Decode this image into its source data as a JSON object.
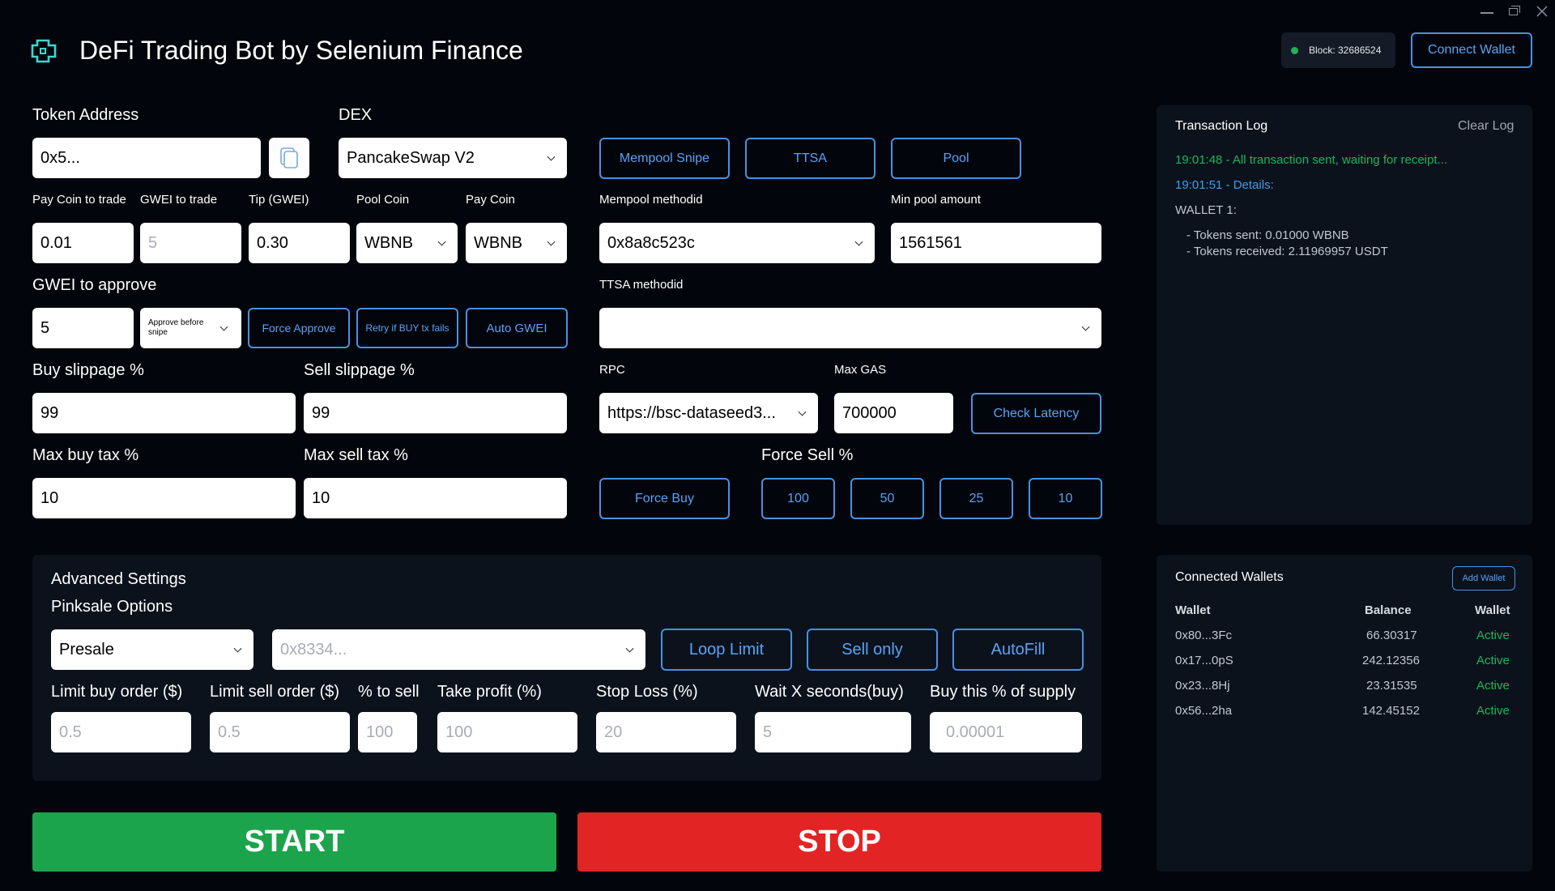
{
  "app": {
    "title": "DeFi Trading Bot by Selenium Finance",
    "block": "Block: 32686524",
    "connect_wallet": "Connect Wallet",
    "block_status_color": "#1fb45a"
  },
  "form": {
    "token_address_label": "Token Address",
    "token_address_value": "0x5...",
    "dex_label": "DEX",
    "dex_value": "PancakeSwap V2",
    "pay_coin_to_trade_label": "Pay Coin to trade",
    "pay_coin_to_trade_value": "0.01",
    "gwei_to_trade_label": "GWEI to trade",
    "gwei_to_trade_placeholder": "5",
    "tip_label": "Tip (GWEI)",
    "tip_value": "0.30",
    "pool_coin_label": "Pool Coin",
    "pool_coin_value": "WBNB",
    "pay_coin_label": "Pay Coin",
    "pay_coin_value": "WBNB",
    "gwei_to_approve_label": "GWEI to approve",
    "gwei_to_approve_value": "5",
    "approve_mode_value": "Approve before snipe",
    "force_approve": "Force Approve",
    "retry_buy": "Retry if BUY tx fails",
    "auto_gwei": "Auto GWEI",
    "buy_slippage_label": "Buy slippage %",
    "buy_slippage_value": "99",
    "sell_slippage_label": "Sell slippage %",
    "sell_slippage_value": "99",
    "max_buy_tax_label": "Max buy tax %",
    "max_buy_tax_value": "10",
    "max_sell_tax_label": "Max sell tax %",
    "max_sell_tax_value": "10"
  },
  "modes": {
    "mempool_snipe": "Mempool Snipe",
    "ttsa": "TTSA",
    "pool": "Pool",
    "mempool_methodid_label": "Mempool methodid",
    "mempool_methodid_value": "0x8a8c523c",
    "min_pool_amount_label": "Min pool amount",
    "min_pool_amount_value": "1561561",
    "ttsa_methodid_label": "TTSA methodid",
    "ttsa_methodid_value": "",
    "rpc_label": "RPC",
    "rpc_value": "https://bsc-dataseed3...",
    "max_gas_label": "Max GAS",
    "max_gas_value": "700000",
    "check_latency": "Check Latency",
    "force_buy": "Force Buy",
    "force_sell_label": "Force Sell %",
    "force_sell_options": [
      "100",
      "50",
      "25",
      "10"
    ]
  },
  "advanced": {
    "title": "Advanced Settings",
    "subtitle": "Pinksale Options",
    "sale_type_value": "Presale",
    "sale_address_placeholder": "0x8334...",
    "loop_limit": "Loop Limit",
    "sell_only": "Sell only",
    "autofill": "AutoFill",
    "limit_buy_label": "Limit buy order ($)",
    "limit_buy_placeholder": "0.5",
    "limit_sell_label": "Limit sell order ($)",
    "limit_sell_placeholder": "0.5",
    "pct_to_sell_label": "% to sell",
    "pct_to_sell_placeholder": "100",
    "take_profit_label": "Take profit (%)",
    "take_profit_placeholder": "100",
    "stop_loss_label": "Stop Loss (%)",
    "stop_loss_placeholder": "20",
    "wait_seconds_label": "Wait X seconds(buy)",
    "wait_seconds_placeholder": "5",
    "buy_pct_supply_label": "Buy this % of supply",
    "buy_pct_supply_placeholder": "0.00001"
  },
  "actions": {
    "start": "START",
    "stop": "STOP",
    "start_color": "#1ca44c",
    "stop_color": "#e22424"
  },
  "log": {
    "title": "Transaction Log",
    "clear": "Clear Log",
    "line1": "19:01:48 - All transaction sent, waiting for receipt...",
    "line2": "19:01:51 - Details:",
    "line3": "WALLET 1:",
    "line4": "- Tokens sent: 0.01000 WBNB",
    "line5": "- Tokens received: 2.11969957 USDT"
  },
  "wallets": {
    "title": "Connected Wallets",
    "add_wallet": "Add Wallet",
    "columns": [
      "Wallet",
      "Balance",
      "Wallet"
    ],
    "rows": [
      {
        "wallet": "0x80...3Fc",
        "balance": "66.30317",
        "status": "Active"
      },
      {
        "wallet": "0x17...0pS",
        "balance": "242.12356",
        "status": "Active"
      },
      {
        "wallet": "0x23...8Hj",
        "balance": "23.31535",
        "status": "Active"
      },
      {
        "wallet": "0x56...2ha",
        "balance": "142.45152",
        "status": "Active"
      }
    ]
  }
}
